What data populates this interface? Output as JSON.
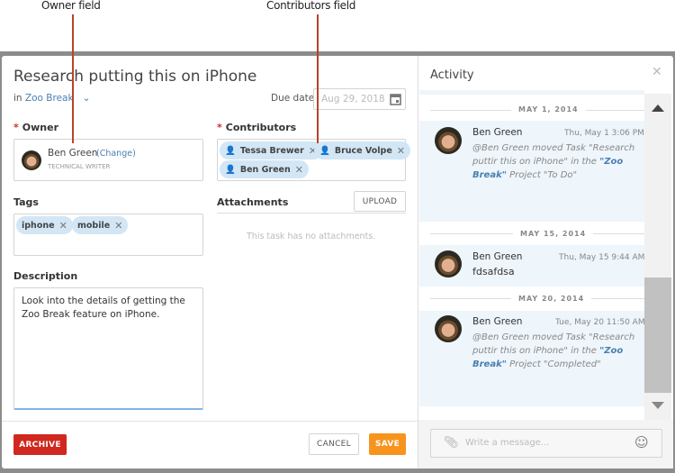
{
  "callouts": {
    "owner": "Owner field",
    "contributors": "Contributors field"
  },
  "task": {
    "title": "Research putting this on iPhone",
    "project_prefix": "in",
    "project": "Zoo Break",
    "due_label": "Due date",
    "due_value": "Aug 29, 2018",
    "owner_label": "Owner",
    "owner": {
      "name": "Ben Green",
      "change": "(Change)",
      "role": "TECHNICAL WRITER"
    },
    "contributors_label": "Contributors",
    "contributors": [
      "Tessa Brewer",
      "Bruce Volpe",
      "Ben Green"
    ],
    "tags_label": "Tags",
    "tags": [
      "iphone",
      "mobile"
    ],
    "attachments_label": "Attachments",
    "upload": "UPLOAD",
    "no_attachments": "This task has no attachments.",
    "description_label": "Description",
    "description": "Look into the details of getting the Zoo Break feature on iPhone.",
    "archive": "ARCHIVE",
    "cancel": "CANCEL",
    "save": "SAVE"
  },
  "activity": {
    "title": "Activity",
    "composer_placeholder": "Write a message...",
    "groups": [
      {
        "date": "MAY 1, 2014",
        "author": "Ben Green",
        "time": "Thu, May 1 3:06 PM M",
        "pre": "@Ben Green moved Task \"Research puttir this on iPhone\" in the ",
        "project": "\"Zoo Break\"",
        "post": " Project \"To Do\""
      },
      {
        "date": "MAY 15, 2014",
        "author": "Ben Green",
        "time": "Thu, May 15 9:44 AM M",
        "text": "fdsafdsa"
      },
      {
        "date": "MAY 20, 2014",
        "author": "Ben Green",
        "time": "Tue, May 20 11:50 AM M",
        "pre": "@Ben Green moved Task \"Research puttir this on iPhone\" in the ",
        "project": "\"Zoo Break\"",
        "post": " Project \"Completed\""
      }
    ]
  },
  "colors": {
    "accent": "#4a7fb0",
    "archive": "#d0281e",
    "save": "#f7941d",
    "callout_line": "#b8432b"
  }
}
